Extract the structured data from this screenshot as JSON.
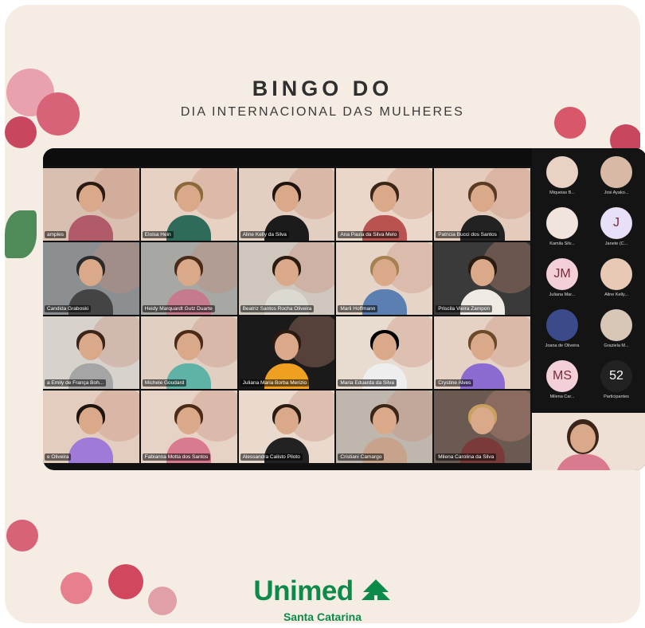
{
  "header": {
    "title": "BINGO DO",
    "subtitle": "DIA INTERNACIONAL DAS MULHERES"
  },
  "brand": {
    "name": "Unimed",
    "region": "Santa Catarina",
    "color": "#0b8a4a"
  },
  "video_grid": {
    "tiles": [
      {
        "name": "amples",
        "bg": "#d9bfb0",
        "hair": "#2b1a12",
        "shirt": "#b15a6a"
      },
      {
        "name": "Eloisa Hein",
        "bg": "#e7d1c3",
        "hair": "#8a6a3a",
        "shirt": "#2e6b5a"
      },
      {
        "name": "Aline Kelly da Silva",
        "bg": "#e2cfc2",
        "hair": "#1f140f",
        "shirt": "#1b1b1b"
      },
      {
        "name": "Ana Paula da Silva Melo",
        "bg": "#ead7ca",
        "hair": "#3b2418",
        "shirt": "#b9534f"
      },
      {
        "name": "Patricia Bucci dos Santos",
        "bg": "#e4cbbb",
        "hair": "#5a3a22",
        "shirt": "#222"
      },
      {
        "name": "Candida Graboski",
        "bg": "#8c8f91",
        "hair": "#2a2a2a",
        "shirt": "#444"
      },
      {
        "name": "Heidy Marquardt Gutz Duarte",
        "bg": "#a7a7a3",
        "hair": "#4a2b18",
        "shirt": "#c57a8e"
      },
      {
        "name": "Beatriz Santos Rocha Oliveira",
        "bg": "#cfc7bd",
        "hair": "#2a1a10",
        "shirt": "#dcdad0"
      },
      {
        "name": "Marli Hoffmann",
        "bg": "#e5d5c8",
        "hair": "#a58050",
        "shirt": "#5a7fb0"
      },
      {
        "name": "Priscila Vieira Zampon",
        "bg": "#3a3a3a",
        "hair": "#2a1a10",
        "shirt": "#efeae4"
      },
      {
        "name": "a Emily de França Boh...",
        "bg": "#d7d2cc",
        "hair": "#3b2418",
        "shirt": "#a5a5a5"
      },
      {
        "name": "Michele Goudard",
        "bg": "#e1cfc2",
        "hair": "#4a2b18",
        "shirt": "#5fb3a6"
      },
      {
        "name": "Juliana Maria Borba Merizio",
        "bg": "#1a1a1a",
        "hair": "#2a1a10",
        "shirt": "#f0a020"
      },
      {
        "name": "Maria Eduarda da Silva",
        "bg": "#e8dcd1",
        "hair": "#000",
        "shirt": "#eee"
      },
      {
        "name": "Crystine Alves",
        "bg": "#e5d2c4",
        "hair": "#6b4a2a",
        "shirt": "#8b6bd0"
      },
      {
        "name": "e Oliveira",
        "bg": "#e2cdbf",
        "hair": "#1f140f",
        "shirt": "#a07ad8"
      },
      {
        "name": "Fabianna Motta dos Santos",
        "bg": "#e6d3c6",
        "hair": "#4a2b18",
        "shirt": "#d97a8e"
      },
      {
        "name": "Alessandra Calisto Piloto",
        "bg": "#e9dacd",
        "hair": "#2a1a10",
        "shirt": "#222"
      },
      {
        "name": "Cristiani Camargo",
        "bg": "#bfb7ae",
        "hair": "#3b2418",
        "shirt": "#c6a38a"
      },
      {
        "name": "Milena Carolina da Silva",
        "bg": "#6a5a52",
        "hair": "#caa060",
        "shirt": "#7a3a3a"
      }
    ]
  },
  "participants_panel": {
    "items": [
      {
        "name": "Miqueias B...",
        "initials": "",
        "color": "#e9d2c4"
      },
      {
        "name": "Josi Ayako...",
        "initials": "",
        "color": "#d8b9a5"
      },
      {
        "name": "Kamila Silv...",
        "initials": "",
        "color": "#f0e4dc"
      },
      {
        "name": "Janete (C...",
        "initials": "J",
        "color": "#e8e0f8"
      },
      {
        "name": "Juliana Mar...",
        "initials": "JM",
        "color": "#f3d0d8"
      },
      {
        "name": "Aline Kelly...",
        "initials": "",
        "color": "#e7c9b5"
      },
      {
        "name": "Joana de Oliveira",
        "initials": "",
        "color": "#3a4a8a"
      },
      {
        "name": "Graziela M...",
        "initials": "",
        "color": "#d8c6b6"
      },
      {
        "name": "Milena Car...",
        "initials": "MS",
        "color": "#f3d0d8"
      },
      {
        "name": "Participantes",
        "initials": "52",
        "color": "#222222"
      }
    ]
  }
}
